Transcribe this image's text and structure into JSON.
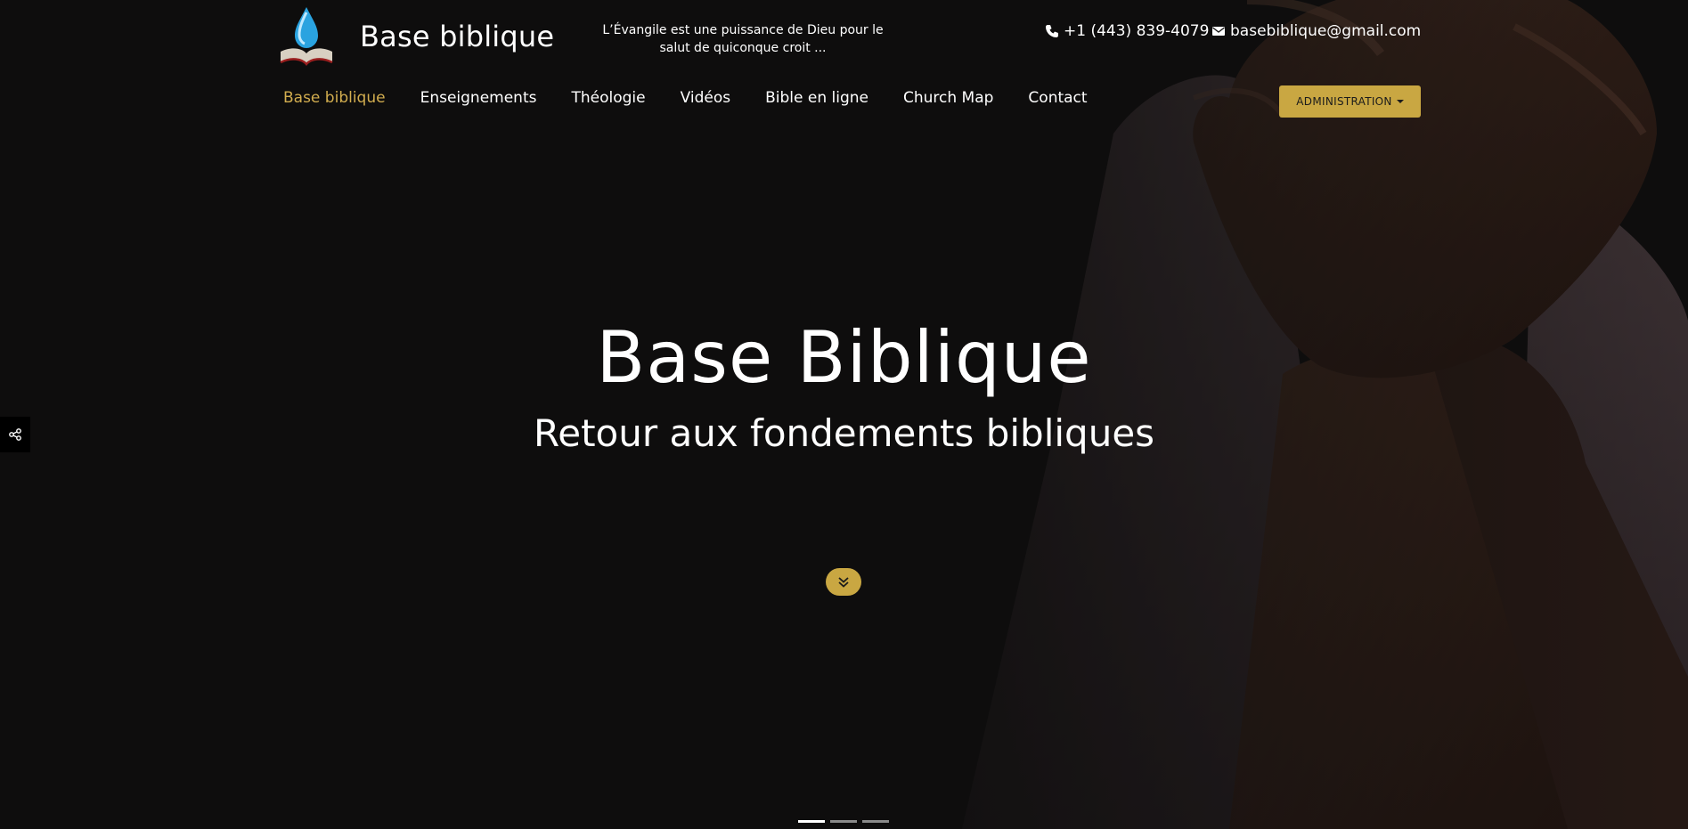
{
  "header": {
    "brand": "Base biblique",
    "tagline": "L’Évangile est une puissance de Dieu pour le salut de quiconque croit ...",
    "phone": "+1 (443) 839-4079",
    "email": "basebiblique@gmail.com",
    "admin_label": "ADMINISTRATION"
  },
  "nav": {
    "items": [
      {
        "label": "Base biblique",
        "active": true
      },
      {
        "label": "Enseignements"
      },
      {
        "label": "Théologie"
      },
      {
        "label": "Vidéos"
      },
      {
        "label": "Bible en ligne"
      },
      {
        "label": "Church Map"
      },
      {
        "label": "Contact"
      }
    ]
  },
  "hero": {
    "title": "Base Biblique",
    "subtitle": "Retour aux fondements bibliques"
  },
  "carousel": {
    "count": 3,
    "active": 0
  },
  "colors": {
    "background": "#161515",
    "accent": "#c9a742",
    "active_nav": "#d2ad4f",
    "text": "#ffffff"
  },
  "icons": {
    "phone": "phone-icon",
    "email": "envelope-icon",
    "share": "share-icon",
    "scroll": "double-chevron-down-icon",
    "logo": "water-drop-on-open-bible-logo"
  }
}
